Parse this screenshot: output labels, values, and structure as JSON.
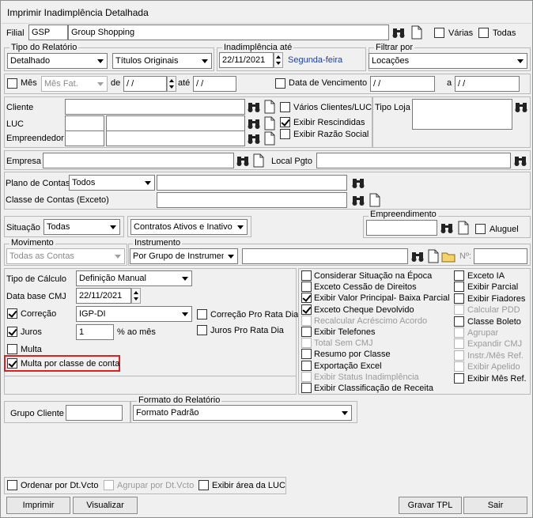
{
  "window": {
    "title": "Imprimir Inadimplência Detalhada"
  },
  "filial": {
    "label": "Filial",
    "code": "GSP",
    "name": "Group Shopping",
    "varias": "Várias",
    "todas": "Todas"
  },
  "tipo_relatorio": {
    "title": "Tipo do Relatório",
    "value1": "Detalhado",
    "value2": "Títulos Originais"
  },
  "inadimplencia": {
    "title": "Inadimplência até",
    "date": "22/11/2021",
    "weekday": "Segunda-feira"
  },
  "filtrar": {
    "title": "Filtrar por",
    "value": "Locações"
  },
  "mes": {
    "label": "Mês",
    "select": "Mês Fat.",
    "de": "de",
    "date_from": " /  /",
    "ate": "até",
    "date_to": " /  /"
  },
  "vencimento": {
    "label": "Data de Vencimento",
    "from": " /  /",
    "a": "a",
    "to": " /  /"
  },
  "cliente": {
    "cliente": "Cliente",
    "luc": "LUC",
    "empreendedor": "Empreendedor",
    "varios": "Vários Clientes/LUC",
    "rescindidas": "Exibir Rescindidas",
    "razao": "Exibir Razão Social",
    "tipo_loja": "Tipo Loja"
  },
  "empresa": {
    "label": "Empresa",
    "local": "Local Pgto"
  },
  "contas": {
    "plano": "Plano de Contas",
    "plano_value": "Todos",
    "classe": "Classe de Contas (Exceto)"
  },
  "situacao": {
    "label": "Situação",
    "value": "Todas",
    "contratos": "Contratos Ativos e Inativo",
    "empreendimento": "Empreendimento",
    "aluguel": "Aluguel"
  },
  "movimento": {
    "title": "Movimento",
    "value": "Todas as Contas"
  },
  "instrumento": {
    "title": "Instrumento",
    "value": "Por Grupo de Instrumen",
    "num": "Nº:"
  },
  "calculo": {
    "tipo": "Tipo de Cálculo",
    "tipo_value": "Definição Manual",
    "data_base": "Data base CMJ",
    "data_value": "22/11/2021",
    "correcao": "Correção",
    "correcao_value": "IGP-DI",
    "juros": "Juros",
    "juros_value": "1",
    "ao_mes": "% ao mês",
    "pro_rata": "Correção Pro Rata Dia",
    "juros_pro": "Juros Pro Rata Dia",
    "multa": "Multa",
    "multa_classe": "Multa por classe de conta"
  },
  "options_mid": [
    "Considerar Situação na Época",
    "Exceto Cessão de Direitos",
    "Exibir Valor Principal- Baixa Parcial",
    "Exceto Cheque Devolvido",
    "Recalcular Acréscimo Acordo",
    "Exibir Telefones",
    "Total Sem CMJ",
    "Resumo por Classe",
    "Exportação Excel",
    "Exibir Status Inadimplência",
    "Exibir Classificação de Receita"
  ],
  "options_right": [
    "Exceto IA",
    "Exibir Parcial",
    "Exibir Fiadores",
    "Calcular PDD",
    "Classe Boleto",
    "Agrupar",
    "Expandir CMJ",
    "Instr./Mês Ref.",
    "Exibir Apelido",
    "Exibir Mês Ref."
  ],
  "grupo": {
    "label": "Grupo Cliente",
    "formato_title": "Formato do Relatório",
    "formato_value": "Formato Padrão"
  },
  "bottom": {
    "ordenar": "Ordenar por Dt.Vcto",
    "agrupar": "Agrupar por Dt.Vcto",
    "exibir_area": "Exibir área da LUC"
  },
  "buttons": {
    "imprimir": "Imprimir",
    "visualizar": "Visualizar",
    "gravar": "Gravar TPL",
    "sair": "Sair"
  }
}
